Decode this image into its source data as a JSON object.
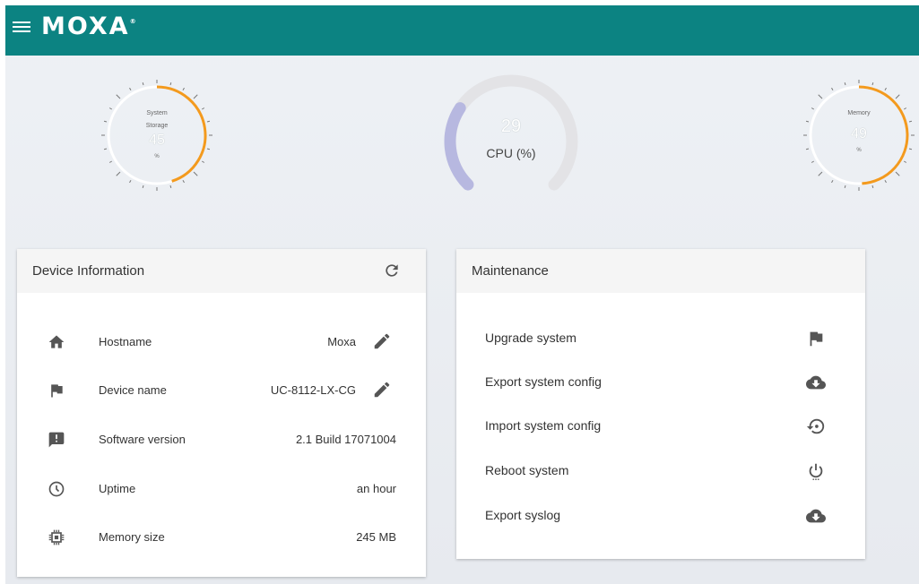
{
  "header": {
    "brand": "MOXA",
    "brand_mark": "®",
    "menu_icon": "hamburger-menu-icon"
  },
  "colors": {
    "topbar": "#0c8382",
    "gauge_accent": "#f39a1e",
    "cpu_arc": "#b7b8e0",
    "cpu_track": "#e3e3e6"
  },
  "gauges": {
    "storage": {
      "label_line1": "System",
      "label_line2": "Storage",
      "value": "45",
      "unit": "%",
      "fill_fraction": 0.45
    },
    "cpu": {
      "value": "29",
      "label": "CPU (%)",
      "fill_fraction": 0.29
    },
    "memory": {
      "label": "Memory",
      "value": "49",
      "unit": "%",
      "fill_fraction": 0.49
    }
  },
  "device_info": {
    "title": "Device Information",
    "refresh_icon": "refresh-icon",
    "rows": [
      {
        "icon": "home-icon",
        "label": "Hostname",
        "value": "Moxa",
        "editable": true
      },
      {
        "icon": "flag-icon",
        "label": "Device name",
        "value": "UC-8112-LX-CG",
        "editable": true
      },
      {
        "icon": "alert-box-icon",
        "label": "Software version",
        "value": "2.1 Build 17071004",
        "editable": false
      },
      {
        "icon": "clock-icon",
        "label": "Uptime",
        "value": "an hour",
        "editable": false
      },
      {
        "icon": "chip-icon",
        "label": "Memory size",
        "value": "245 MB",
        "editable": false
      }
    ]
  },
  "maintenance": {
    "title": "Maintenance",
    "items": [
      {
        "label": "Upgrade system",
        "icon": "flag-icon"
      },
      {
        "label": "Export system config",
        "icon": "cloud-download-icon"
      },
      {
        "label": "Import system config",
        "icon": "restore-icon"
      },
      {
        "label": "Reboot system",
        "icon": "power-icon"
      },
      {
        "label": "Export syslog",
        "icon": "cloud-download-icon"
      }
    ]
  }
}
